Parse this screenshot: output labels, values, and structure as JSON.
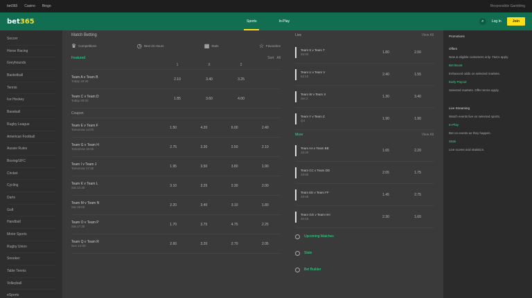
{
  "topbar": {
    "items": [
      "bet365",
      "Casino",
      "Bingo"
    ],
    "right": "Responsible Gambling"
  },
  "header": {
    "logo_a": "bet",
    "logo_b": "365",
    "nav": [
      "Sports",
      "In-Play"
    ],
    "login_label": "Log In",
    "join_label": "Join"
  },
  "sidebar": {
    "items": [
      "Soccer",
      "Horse Racing",
      "Greyhounds",
      "Basketball",
      "Tennis",
      "Ice Hockey",
      "Baseball",
      "Rugby League",
      "American Football",
      "Aussie Rules",
      "Boxing/UFC",
      "Cricket",
      "Cycling",
      "Darts",
      "Golf",
      "Handball",
      "Motor Sports",
      "Rugby Union",
      "Snooker",
      "Table Tennis",
      "Volleyball",
      "eSports"
    ]
  },
  "main": {
    "title": "Match Betting",
    "selectors": [
      {
        "icon": "trophy-icon",
        "text": "Competitions"
      },
      {
        "icon": "clock-icon",
        "text": "Next 24 Hours"
      },
      {
        "icon": "chart-icon",
        "text": "Stats"
      },
      {
        "icon": "star-icon",
        "text": "Favourites"
      }
    ],
    "section": "Featured",
    "section_right": [
      "Sort",
      "All"
    ],
    "col_headers": [
      "1",
      "X",
      "2"
    ],
    "group1": [
      {
        "teams": "Team A v Team B",
        "meta": "Today 19:45",
        "odds": [
          "2.10",
          "3.40",
          "3.25"
        ]
      },
      {
        "teams": "Team C v Team D",
        "meta": "Today 20:00",
        "odds": [
          "1.85",
          "3.60",
          "4.00"
        ]
      }
    ],
    "group2_label": "Coupon",
    "group2": [
      {
        "teams": "Team E v Team F",
        "meta": "Tomorrow 14:00",
        "odds": [
          "1.50",
          "4.20",
          "6.00",
          "2.40"
        ]
      },
      {
        "teams": "Team G v Team H",
        "meta": "Tomorrow 15:00",
        "odds": [
          "2.75",
          "3.30",
          "2.50",
          "2.10"
        ]
      },
      {
        "teams": "Team I v Team J",
        "meta": "Tomorrow 17:30",
        "odds": [
          "1.95",
          "3.50",
          "3.80",
          "1.90"
        ]
      },
      {
        "teams": "Team K v Team L",
        "meta": "Sat 12:30",
        "odds": [
          "3.10",
          "3.25",
          "2.30",
          "2.00"
        ]
      },
      {
        "teams": "Team M v Team N",
        "meta": "Sat 15:00",
        "odds": [
          "2.20",
          "3.40",
          "3.10",
          "1.80"
        ]
      },
      {
        "teams": "Team O v Team P",
        "meta": "Sat 17:30",
        "odds": [
          "1.70",
          "3.75",
          "4.75",
          "2.25"
        ]
      },
      {
        "teams": "Team Q v Team R",
        "meta": "Sun 14:00",
        "odds": [
          "2.60",
          "3.20",
          "2.70",
          "2.05"
        ]
      }
    ]
  },
  "mid": {
    "header": "Live",
    "header_right": "View All",
    "rows": [
      {
        "teams": "Team S v Team T",
        "meta": "45:00",
        "odds": [
          "1.80",
          "2.00"
        ]
      },
      {
        "teams": "Team U v Team V",
        "meta": "62:10",
        "odds": [
          "2.40",
          "1.55"
        ]
      },
      {
        "teams": "Team W v Team X",
        "meta": "Set 2",
        "odds": [
          "1.30",
          "3.40"
        ]
      },
      {
        "teams": "Team Y v Team Z",
        "meta": "Q3",
        "odds": [
          "1.90",
          "1.90"
        ]
      }
    ],
    "sub_label": "More",
    "sub_right": "View All",
    "rows2": [
      {
        "teams": "Team AA v Team BB",
        "meta": "18:30",
        "odds": [
          "1.65",
          "2.20"
        ]
      },
      {
        "teams": "Team CC v Team DD",
        "meta": "19:00",
        "odds": [
          "2.05",
          "1.75"
        ]
      },
      {
        "teams": "Team EE v Team FF",
        "meta": "19:45",
        "odds": [
          "1.45",
          "2.75"
        ]
      },
      {
        "teams": "Team GG v Team HH",
        "meta": "20:15",
        "odds": [
          "2.30",
          "1.60"
        ]
      }
    ],
    "links": [
      "Upcoming Matches",
      "Stats",
      "Bet Builder"
    ]
  },
  "right": {
    "title": "Promotions",
    "paras": [
      {
        "text": "Offers",
        "style": "w"
      },
      {
        "text": "New & eligible customers only. T&Cs apply.",
        "style": ""
      },
      {
        "text": "Bet Boost",
        "style": "g"
      },
      {
        "text": "Enhanced odds on selected markets.",
        "style": ""
      },
      {
        "text": "Early Payout",
        "style": "g"
      },
      {
        "text": "Selected markets. Offer terms apply.",
        "style": ""
      },
      {
        "text": "Live Streaming",
        "style": "w"
      },
      {
        "text": "Watch events live on selected sports.",
        "style": ""
      },
      {
        "text": "In-Play",
        "style": "g"
      },
      {
        "text": "Bet on events as they happen.",
        "style": ""
      },
      {
        "text": "Stats",
        "style": "g"
      },
      {
        "text": "Live scores and statistics.",
        "style": ""
      }
    ]
  }
}
